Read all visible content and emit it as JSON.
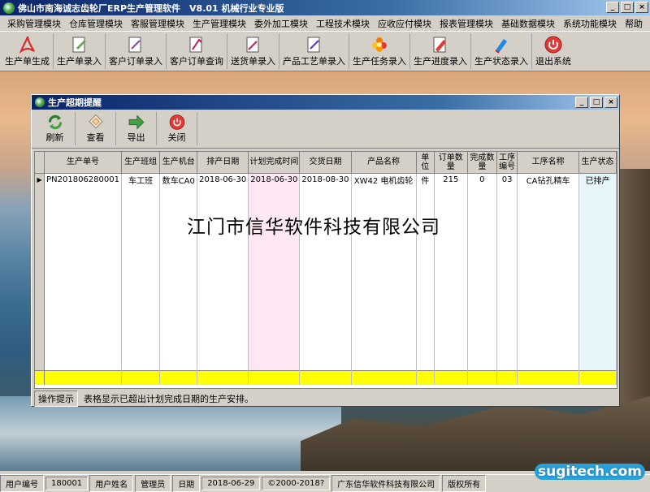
{
  "window": {
    "title": "佛山市南海诚志齿轮厂ERP生产管理软件　V8.01 机械行业专业版"
  },
  "menu": [
    "采购管理模块",
    "仓库管理模块",
    "客服管理模块",
    "生产管理模块",
    "委外加工模块",
    "工程技术模块",
    "应收应付模块",
    "报表管理模块",
    "基础数据模块",
    "系统功能模块",
    "帮助"
  ],
  "toolbar": [
    {
      "label": "生产单生成",
      "icon": "acrobat-icon"
    },
    {
      "label": "生产单录入",
      "icon": "document-pen-icon"
    },
    {
      "label": "客户订单录入",
      "icon": "document-icon"
    },
    {
      "label": "客户订单查询",
      "icon": "search-doc-icon"
    },
    {
      "label": "送货单录入",
      "icon": "delivery-icon"
    },
    {
      "label": "产品工艺单录入",
      "icon": "process-doc-icon"
    },
    {
      "label": "生产任务录入",
      "icon": "flower-icon"
    },
    {
      "label": "生产进度录入",
      "icon": "progress-icon"
    },
    {
      "label": "生产状态录入",
      "icon": "pen-icon"
    },
    {
      "label": "退出系统",
      "icon": "exit-icon"
    }
  ],
  "child_window": {
    "title": "生产超期提醒",
    "buttons": [
      {
        "label": "刷新",
        "icon": "refresh-icon"
      },
      {
        "label": "查看",
        "icon": "view-icon"
      },
      {
        "label": "导出",
        "icon": "export-arrow-icon"
      },
      {
        "label": "关闭",
        "icon": "close-circle-icon"
      }
    ],
    "columns": [
      "生产单号",
      "生产班组",
      "生产机台",
      "排产日期",
      "计划完成时间",
      "交货日期",
      "产品名称",
      "单位",
      "订单数量",
      "完成数量",
      "工序编号",
      "工序名称",
      "生产状态"
    ],
    "rows": [
      [
        "PN201806280001",
        "车工班",
        "数车CA0",
        "2018-06-30",
        "2018-06-30",
        "2018-08-30",
        "XW42 电机齿轮",
        "件",
        "215",
        "0",
        "03",
        "CA钻孔精车",
        "已排产"
      ]
    ],
    "hint_label": "操作提示",
    "hint_text": "表格显示已超出计划完成日期的生产安排。"
  },
  "watermark": "江门市信华软件科技有限公司",
  "statusbar": {
    "user_id_label": "用户编号",
    "user_id": "180001",
    "user_name_label": "用户姓名",
    "user_name": "管理员",
    "date_label": "日期",
    "date": "2018-06-29",
    "copyright": "©2000-2018?",
    "company": "广东信华软件科技有限公司",
    "rights": "版权所有"
  },
  "logo": "sugitech.com",
  "colors": {
    "titlebar": "#0a246a",
    "sum_row": "#ffff00",
    "planned_col": "#fde7f3"
  }
}
